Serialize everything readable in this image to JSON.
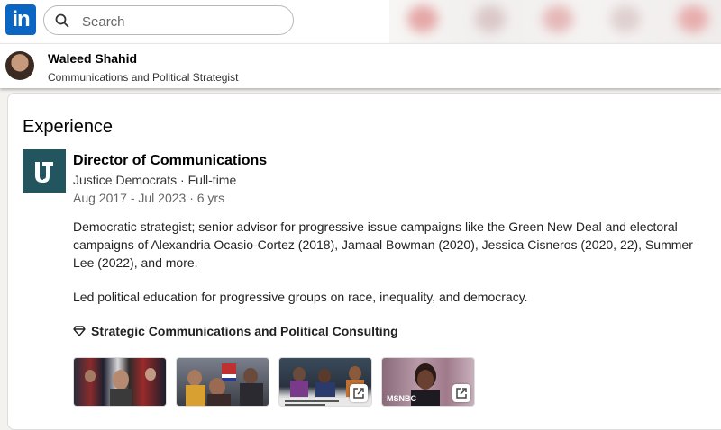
{
  "header": {
    "logo_text": "in",
    "search_placeholder": "Search"
  },
  "profile": {
    "name": "Waleed Shahid",
    "headline": "Communications and Political Strategist"
  },
  "experience": {
    "section_title": "Experience",
    "items": [
      {
        "title": "Director of Communications",
        "company": "Justice Democrats · Full-time",
        "dates": "Aug 2017 - Jul 2023 · 6 yrs",
        "description": "Democratic strategist; senior advisor for progressive issue campaigns like the Green New Deal and electoral campaigns of Alexandria Ocasio-Cortez (2018), Jamaal Bowman (2020), Jessica Cisneros (2020, 22), Summer Lee (2022), and more.",
        "description2": "Led political education for progressive groups on race, inequality, and democracy.",
        "skills": "Strategic Communications and Political Consulting",
        "media": [
          {
            "label": ""
          },
          {
            "label": ""
          },
          {
            "label": ""
          },
          {
            "label": "MSNBC"
          }
        ]
      }
    ]
  },
  "colors": {
    "brand": "#0a66c2",
    "company_logo_bg": "#22555d"
  }
}
